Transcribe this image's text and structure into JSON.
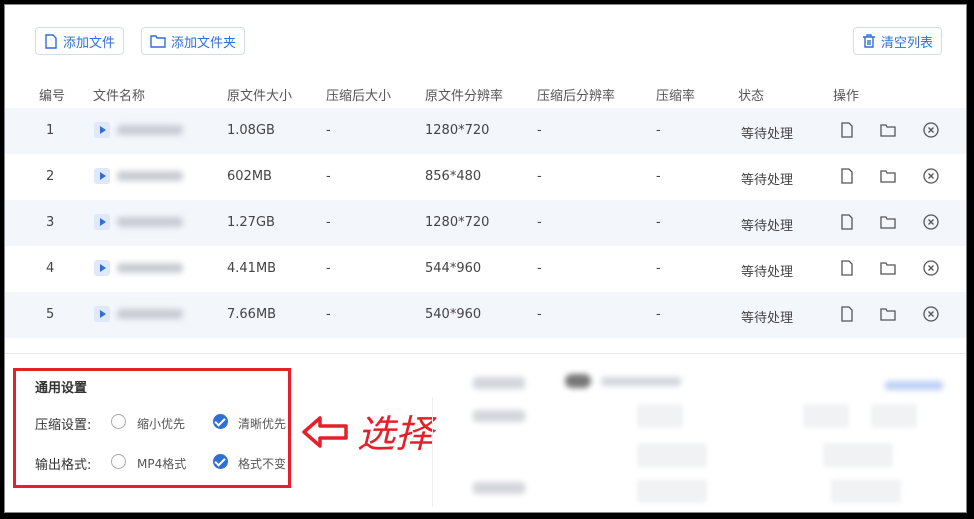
{
  "toolbar": {
    "add_file": "添加文件",
    "add_folder": "添加文件夹",
    "clear_list": "清空列表"
  },
  "table": {
    "headers": [
      "编号",
      "文件名称",
      "原文件大小",
      "压缩后大小",
      "原文件分辨率",
      "压缩后分辨率",
      "压缩率",
      "状态",
      "操作"
    ],
    "rows": [
      {
        "no": "1",
        "size": "1.08GB",
        "csize": "-",
        "res": "1280*720",
        "cres": "-",
        "rate": "-",
        "status": "等待处理"
      },
      {
        "no": "2",
        "size": "602MB",
        "csize": "-",
        "res": "856*480",
        "cres": "-",
        "rate": "-",
        "status": "等待处理"
      },
      {
        "no": "3",
        "size": "1.27GB",
        "csize": "-",
        "res": "1280*720",
        "cres": "-",
        "rate": "-",
        "status": "等待处理"
      },
      {
        "no": "4",
        "size": "4.41MB",
        "csize": "-",
        "res": "544*960",
        "cres": "-",
        "rate": "-",
        "status": "等待处理"
      },
      {
        "no": "5",
        "size": "7.66MB",
        "csize": "-",
        "res": "540*960",
        "cres": "-",
        "rate": "-",
        "status": "等待处理"
      }
    ]
  },
  "settings": {
    "title": "通用设置",
    "compress_label": "压缩设置:",
    "compress_opts": [
      "缩小优先",
      "清晰优先"
    ],
    "format_label": "输出格式:",
    "format_opts": [
      "MP4格式",
      "格式不变"
    ]
  },
  "annotation": {
    "text": "选择",
    "color": "#e5202a"
  }
}
